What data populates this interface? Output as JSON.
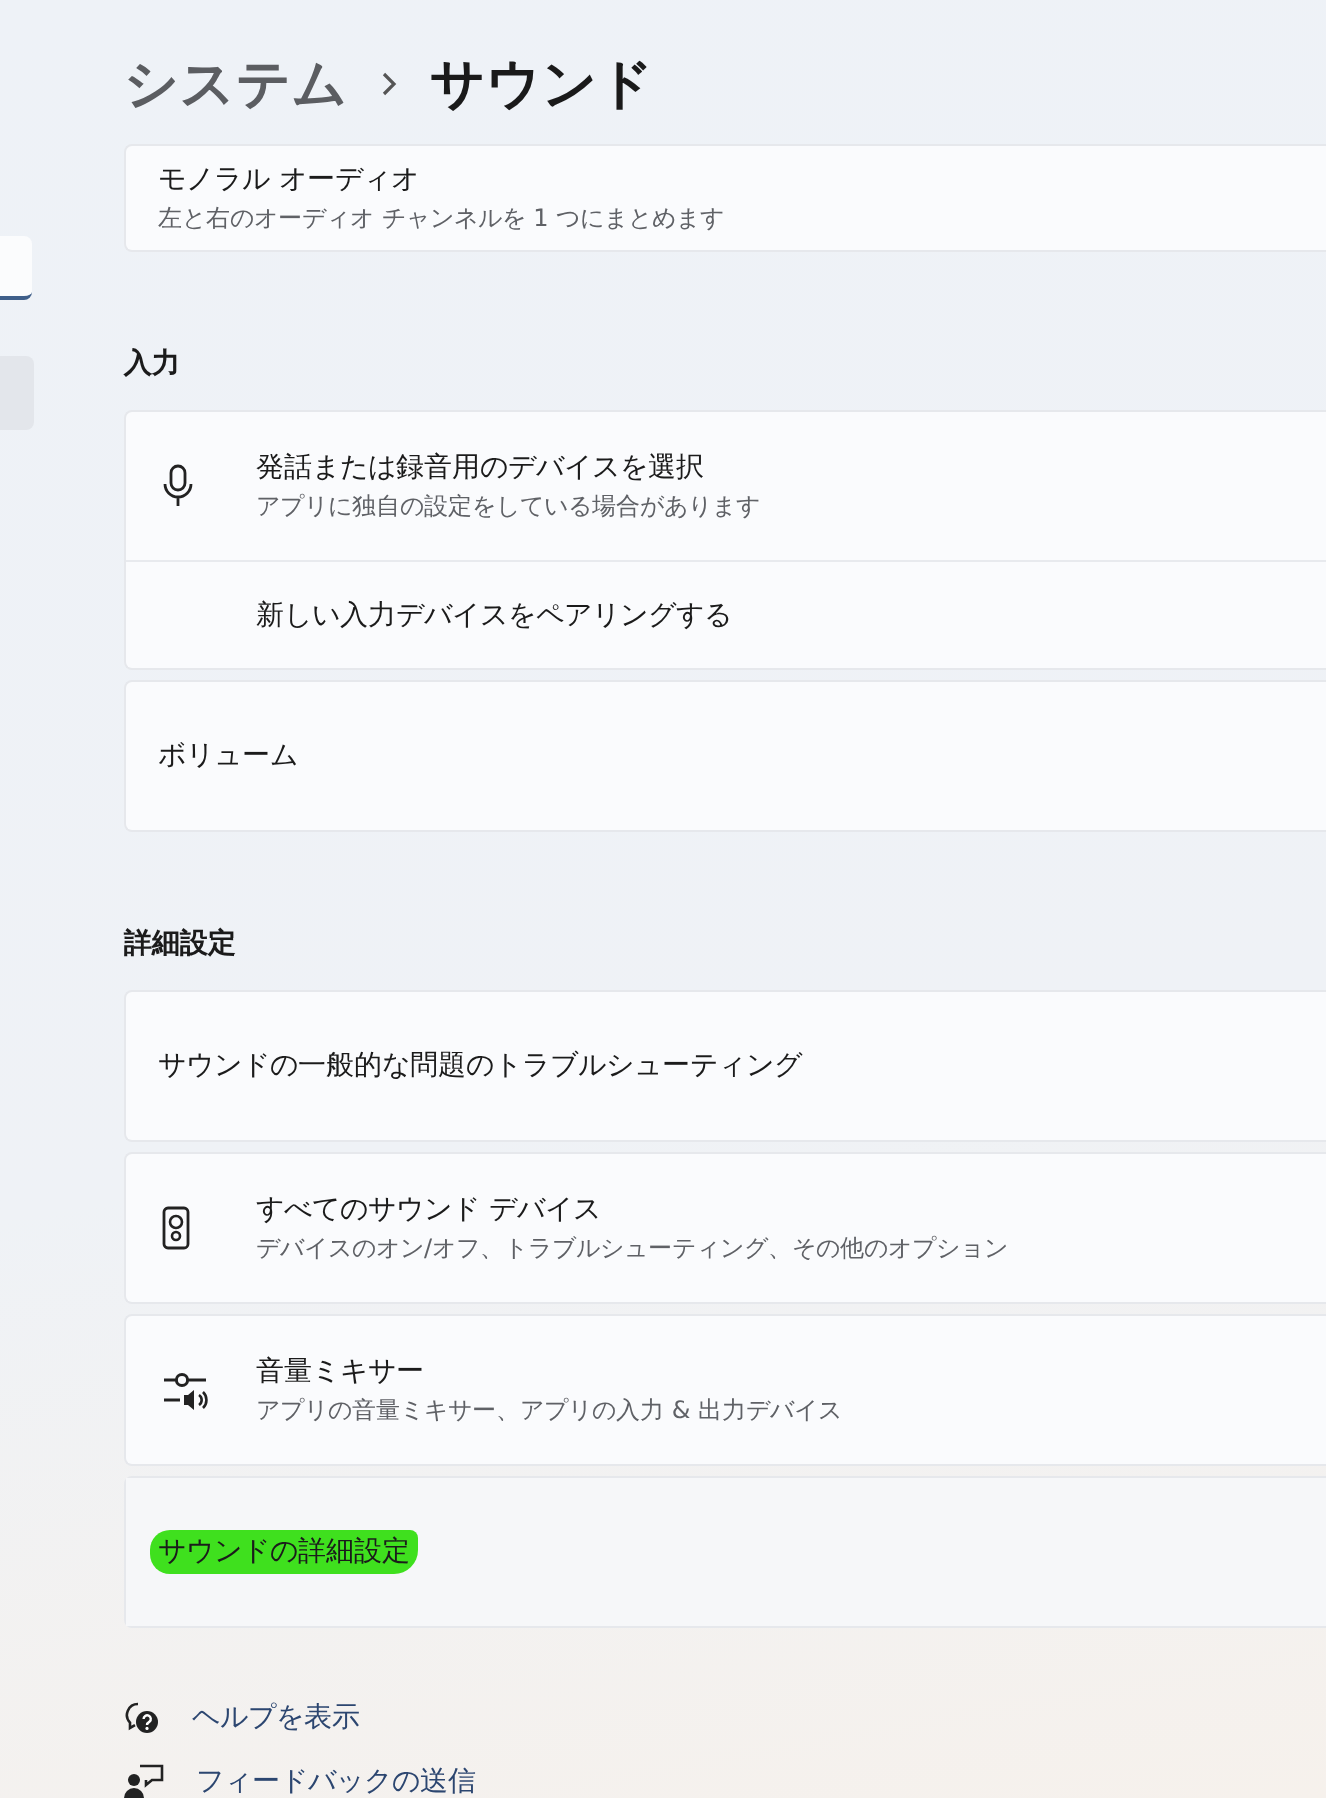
{
  "breadcrumb": {
    "parent": "システム",
    "current": "サウンド"
  },
  "blocks": [
    {
      "kind": "card",
      "rows": [
        {
          "kind": "plain",
          "title": "モノラル オーディオ",
          "subtitle": "左と右のオーディオ チャンネルを 1 つにまとめます",
          "highlighted": false
        }
      ]
    },
    {
      "kind": "heading",
      "text": "入力"
    },
    {
      "kind": "card",
      "rows": [
        {
          "kind": "mic",
          "title": "発話または録音用のデバイスを選択",
          "subtitle": "アプリに独自の設定をしている場合があります",
          "highlighted": false
        },
        {
          "kind": "inset",
          "title": "新しい入力デバイスをペアリングする",
          "highlighted": false
        }
      ]
    },
    {
      "kind": "card",
      "rows": [
        {
          "kind": "plain",
          "title": "ボリューム",
          "highlighted": false
        }
      ]
    },
    {
      "kind": "heading",
      "text": "詳細設定"
    },
    {
      "kind": "card",
      "rows": [
        {
          "kind": "plain",
          "title": "サウンドの一般的な問題のトラブルシューティング",
          "highlighted": false
        }
      ]
    },
    {
      "kind": "card",
      "rows": [
        {
          "kind": "speaker",
          "title": "すべてのサウンド デバイス",
          "subtitle": "デバイスのオン/オフ、トラブルシューティング、その他のオプション",
          "highlighted": false
        }
      ]
    },
    {
      "kind": "card",
      "rows": [
        {
          "kind": "mixer",
          "title": "音量ミキサー",
          "subtitle": "アプリの音量ミキサー、アプリの入力 & 出力デバイス",
          "highlighted": false
        }
      ]
    },
    {
      "kind": "card",
      "rows": [
        {
          "kind": "plain",
          "title": "サウンドの詳細設定",
          "highlighted": true
        }
      ]
    }
  ],
  "links": [
    {
      "kind": "help",
      "label": "ヘルプを表示"
    },
    {
      "kind": "feedback",
      "label": "フィードバックの送信"
    }
  ]
}
